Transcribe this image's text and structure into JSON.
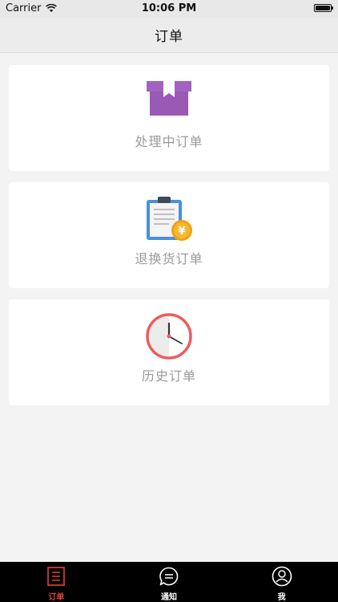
{
  "status_bar": {
    "carrier": "Carrier",
    "time": "10:06 PM"
  },
  "nav": {
    "title": "订单"
  },
  "cards": [
    {
      "label": "处理中订单",
      "icon": "box-icon"
    },
    {
      "label": "退换货订单",
      "icon": "clipboard-yen-icon"
    },
    {
      "label": "历史订单",
      "icon": "clock-icon"
    }
  ],
  "tabs": [
    {
      "label": "订单",
      "icon": "orders-list-icon",
      "active": true
    },
    {
      "label": "通知",
      "icon": "chat-bubble-icon",
      "active": false
    },
    {
      "label": "我",
      "icon": "user-profile-icon",
      "active": false
    }
  ],
  "colors": {
    "accent": "#e54335",
    "box_purple": "#9b59b6",
    "clipboard_blue": "#4a90d9",
    "coin_orange": "#f0a20f",
    "clock_red": "#ee5b5b"
  }
}
